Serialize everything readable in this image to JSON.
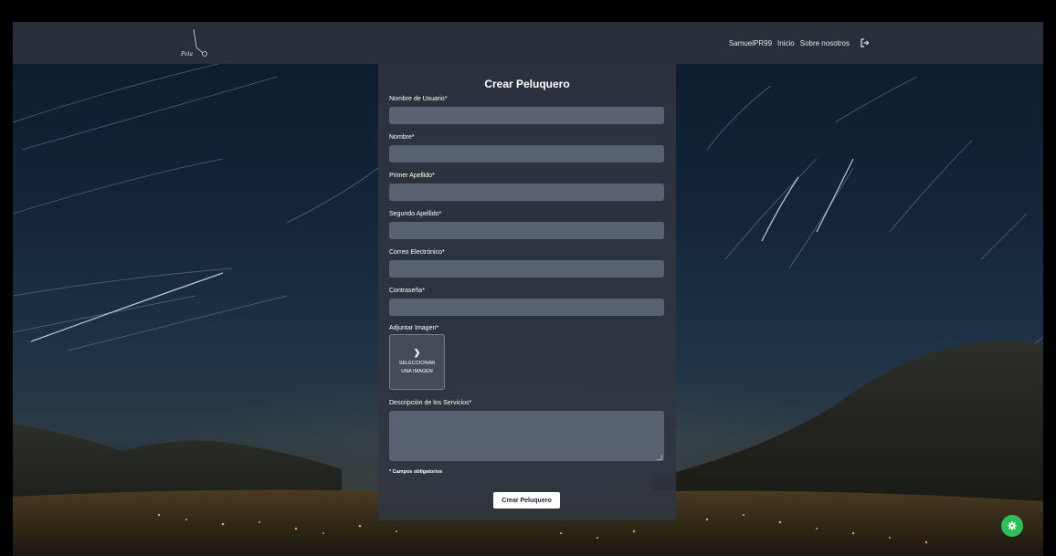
{
  "navbar": {
    "logo_text": "Pelu",
    "user_name": "SamuelPR99",
    "links": [
      {
        "label": "Inicio"
      },
      {
        "label": "Sobre nosotros"
      }
    ],
    "logout_icon": "sign-out-icon"
  },
  "form": {
    "title": "Crear Peluquero",
    "fields": [
      {
        "label": "Nombre de Usuario*",
        "value": "",
        "placeholder": ""
      },
      {
        "label": "Nombre*",
        "value": "",
        "placeholder": ""
      },
      {
        "label": "Primer Apellido*",
        "value": "",
        "placeholder": ""
      },
      {
        "label": "Segundo Apellido*",
        "value": "",
        "placeholder": ""
      },
      {
        "label": "Correo Electrónico*",
        "value": "",
        "placeholder": ""
      },
      {
        "label": "Contraseña*",
        "value": "",
        "placeholder": ""
      }
    ],
    "image": {
      "label": "Adjuntar Imagen*",
      "button_line1": "SELECCIONAR",
      "button_line2": "UNA IMAGEN",
      "icon": "chevron-right-icon"
    },
    "description": {
      "label": "Descripción de los Servicios*",
      "value": ""
    },
    "required_note": "* Campos obligatorios",
    "submit_label": "Crear Peluquero"
  },
  "fab": {
    "icon": "gear-icon"
  },
  "colors": {
    "navbar_bg": "#2a303a",
    "panel_bg": "#303640",
    "input_bg": "#596270",
    "fab_green": "#2ebf5a"
  }
}
